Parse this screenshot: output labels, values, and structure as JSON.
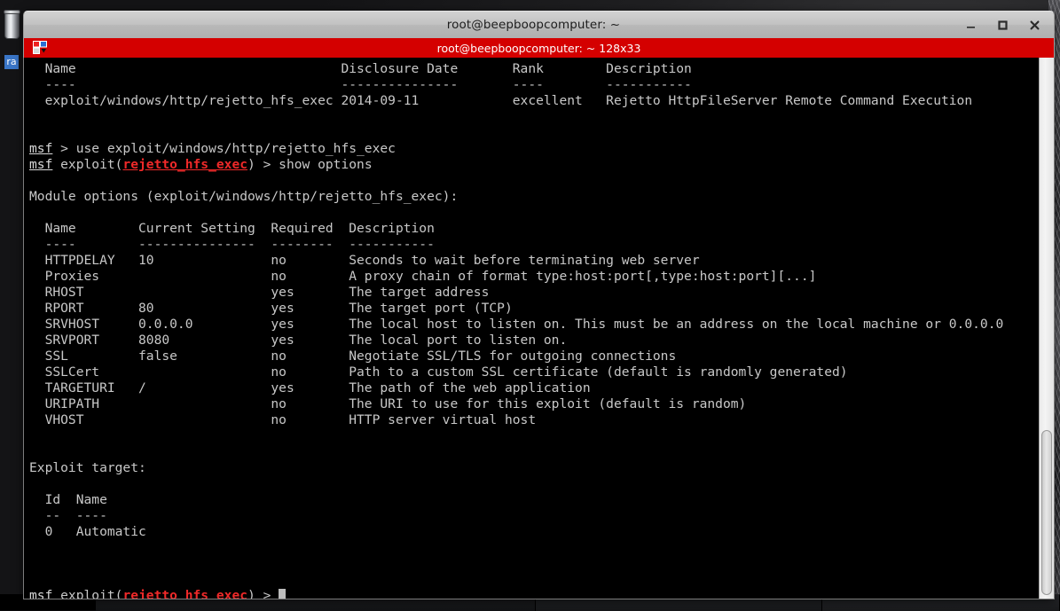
{
  "window": {
    "title": "root@beepboopcomputer: ~",
    "controls": {
      "minimize_label": "Minimize",
      "maximize_label": "Maximize",
      "close_label": "Close"
    }
  },
  "tabbar": {
    "menu_icon": "window-list-icon",
    "tab_title": "root@beepboopcomputer: ~ 128x33",
    "accent_color": "#d40000"
  },
  "desktop": {
    "trash_icon": "trash-can-icon",
    "selected_label_fragment": "ra",
    "taskbar": {
      "buttons": [
        "",
        "",
        ""
      ]
    }
  },
  "terminal": {
    "colors": {
      "background": "#000000",
      "foreground": "#c8c8c8",
      "prompt_red": "#ef2929",
      "cursor": "#bdbdbd"
    },
    "search_results": {
      "headers": [
        "Name",
        "Disclosure Date",
        "Rank",
        "Description"
      ],
      "separators": [
        "----",
        "---------------",
        "----",
        "-----------"
      ],
      "rows": [
        {
          "name": "exploit/windows/http/rejetto_hfs_exec",
          "disclosure_date": "2014-09-11",
          "rank": "excellent",
          "description": "Rejetto HttpFileServer Remote Command Execution"
        }
      ]
    },
    "commands": [
      {
        "prompt": "msf",
        "suffix": " > ",
        "command": "use exploit/windows/http/rejetto_hfs_exec"
      },
      {
        "prompt": "msf",
        "context": "rejetto_hfs_exec",
        "suffix": " > ",
        "command": "show options"
      }
    ],
    "module_options_title": "Module options (exploit/windows/http/rejetto_hfs_exec):",
    "options_table": {
      "headers": [
        "Name",
        "Current Setting",
        "Required",
        "Description"
      ],
      "separators": [
        "----",
        "---------------",
        "--------",
        "-----------"
      ],
      "rows": [
        {
          "name": "HTTPDELAY",
          "current_setting": "10",
          "required": "no",
          "description": "Seconds to wait before terminating web server"
        },
        {
          "name": "Proxies",
          "current_setting": "",
          "required": "no",
          "description": "A proxy chain of format type:host:port[,type:host:port][...]"
        },
        {
          "name": "RHOST",
          "current_setting": "",
          "required": "yes",
          "description": "The target address"
        },
        {
          "name": "RPORT",
          "current_setting": "80",
          "required": "yes",
          "description": "The target port (TCP)"
        },
        {
          "name": "SRVHOST",
          "current_setting": "0.0.0.0",
          "required": "yes",
          "description": "The local host to listen on. This must be an address on the local machine or 0.0.0.0"
        },
        {
          "name": "SRVPORT",
          "current_setting": "8080",
          "required": "yes",
          "description": "The local port to listen on."
        },
        {
          "name": "SSL",
          "current_setting": "false",
          "required": "no",
          "description": "Negotiate SSL/TLS for outgoing connections"
        },
        {
          "name": "SSLCert",
          "current_setting": "",
          "required": "no",
          "description": "Path to a custom SSL certificate (default is randomly generated)"
        },
        {
          "name": "TARGETURI",
          "current_setting": "/",
          "required": "yes",
          "description": "The path of the web application"
        },
        {
          "name": "URIPATH",
          "current_setting": "",
          "required": "no",
          "description": "The URI to use for this exploit (default is random)"
        },
        {
          "name": "VHOST",
          "current_setting": "",
          "required": "no",
          "description": "HTTP server virtual host"
        }
      ]
    },
    "exploit_target_title": "Exploit target:",
    "exploit_target": {
      "headers": [
        "Id",
        "Name"
      ],
      "separators": [
        "--",
        "----"
      ],
      "rows": [
        {
          "id": "0",
          "name": "Automatic"
        }
      ]
    },
    "final_prompt": {
      "prompt": "msf",
      "context": "rejetto_hfs_exec",
      "suffix": " > "
    }
  }
}
